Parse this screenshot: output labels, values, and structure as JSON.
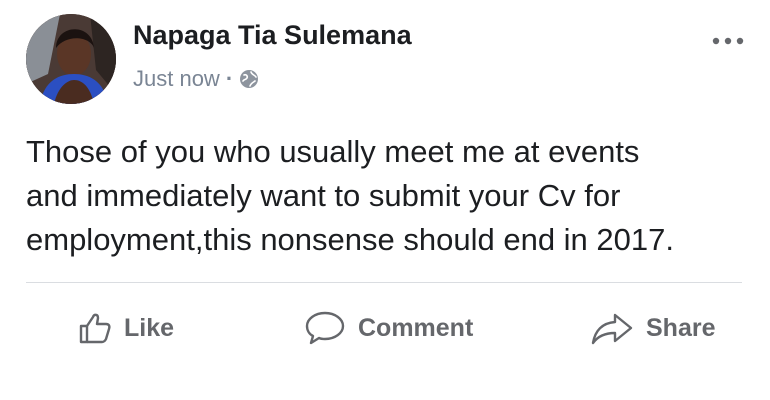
{
  "post": {
    "author": "Napaga Tia Sulemana",
    "timestamp": "Just now",
    "separator": "·",
    "privacy_icon": "globe-icon",
    "body": "Those of you who usually meet me at events\nand immediately want to submit your Cv for\nemployment,this nonsense should end in 2017."
  },
  "actions": {
    "like_label": "Like",
    "comment_label": "Comment",
    "share_label": "Share"
  },
  "colors": {
    "text": "#1c1e21",
    "meta": "#7a8594",
    "action": "#65676b",
    "divider": "#dadde1"
  }
}
